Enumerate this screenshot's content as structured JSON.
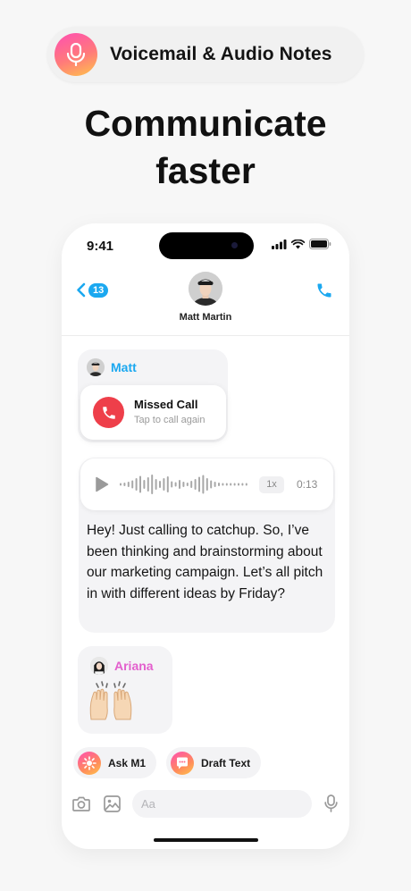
{
  "feature": {
    "label": "Voicemail & Audio Notes",
    "icon": "microphone-icon"
  },
  "headline": {
    "line1": "Communicate",
    "line2": "faster"
  },
  "status_bar": {
    "time": "9:41"
  },
  "header": {
    "unread_count": "13",
    "contact_name": "Matt Martin"
  },
  "messages": {
    "matt": {
      "sender": "Matt",
      "sender_color": "#1ba8f0",
      "missed_call": {
        "title": "Missed Call",
        "subtitle": "Tap to call again"
      }
    },
    "voice_note": {
      "speed": "1x",
      "duration": "0:13",
      "transcript": "Hey! Just calling to catchup. So, I’ve been thinking and brainstorming about our marketing campaign. Let’s all pitch in with different ideas by Friday?"
    },
    "ariana": {
      "sender": "Ariana",
      "sender_color": "#e35fcd",
      "reaction": "raised-hands"
    }
  },
  "actions": [
    {
      "label": "Ask M1",
      "icon": "sparkle-icon"
    },
    {
      "label": "Draft Text",
      "icon": "chat-bubble-icon"
    }
  ],
  "composer": {
    "placeholder": "Aa"
  },
  "colors": {
    "accent": "#1ba8f0",
    "missed": "#ee3f4a"
  }
}
